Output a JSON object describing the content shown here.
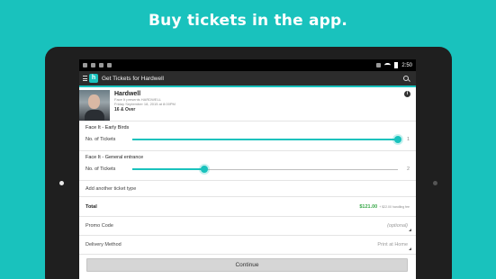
{
  "headline": "Buy tickets in the app.",
  "status_bar": {
    "time": "2:50"
  },
  "app_bar": {
    "logo": "h",
    "title": "Get Tickets for Hardwell"
  },
  "artist": {
    "name": "Hardwell",
    "presenter": "Face It presents HARDWELL",
    "date": "Friday September 18, 2015 at 8:00PM",
    "age": "16 & Over"
  },
  "tickets": [
    {
      "name": "Face It - Early Birds",
      "label": "No. of Tickets",
      "count": "1",
      "fraction": 1.0
    },
    {
      "name": "Face It - General entrance",
      "label": "No. of Tickets",
      "count": "2",
      "fraction": 0.27
    }
  ],
  "add_ticket_label": "Add another ticket type",
  "total": {
    "label": "Total",
    "amount": "$121.00",
    "fee": "+ $22.00 handling fee"
  },
  "promo": {
    "label": "Promo Code",
    "value": "(optional)"
  },
  "delivery": {
    "label": "Delivery Method",
    "value": "Print at Home"
  },
  "continue_label": "Continue",
  "colors": {
    "accent": "#19c2bd",
    "total_green": "#3aa84a"
  }
}
